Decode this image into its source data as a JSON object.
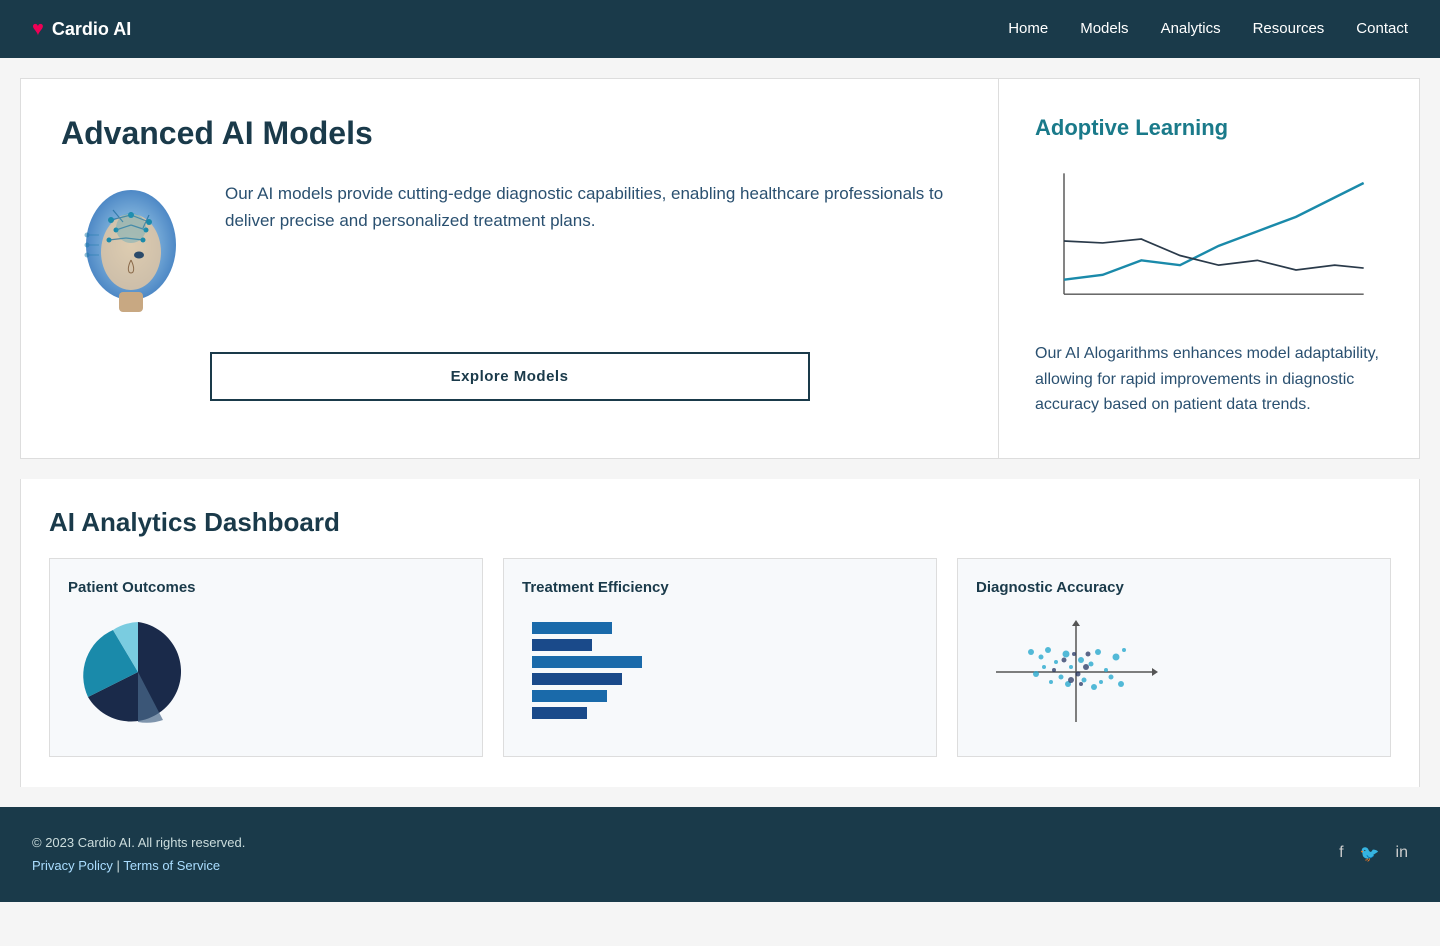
{
  "nav": {
    "logo": "Cardio AI",
    "links": [
      "Home",
      "Models",
      "Analytics",
      "Resources",
      "Contact"
    ]
  },
  "hero": {
    "title": "Advanced AI Models",
    "description": "Our AI models provide cutting-edge diagnostic capabilities, enabling healthcare professionals to deliver precise and personalized treatment plans.",
    "explore_btn": "Explore Models"
  },
  "adaptive": {
    "title": "Adoptive  Learning",
    "description": "Our AI Alogarithms enhances model adaptability, allowing for rapid improvements in diagnostic accuracy based on patient data trends."
  },
  "dashboard": {
    "title": "AI Analytics Dashboard",
    "cards": [
      {
        "title": "Patient Outcomes"
      },
      {
        "title": "Treatment Efficiency"
      },
      {
        "title": "Diagnostic Accuracy"
      }
    ]
  },
  "footer": {
    "copyright": "© 2023 Cardio AI. All rights reserved.",
    "links": "Privacy Policy | Terms of Service"
  }
}
